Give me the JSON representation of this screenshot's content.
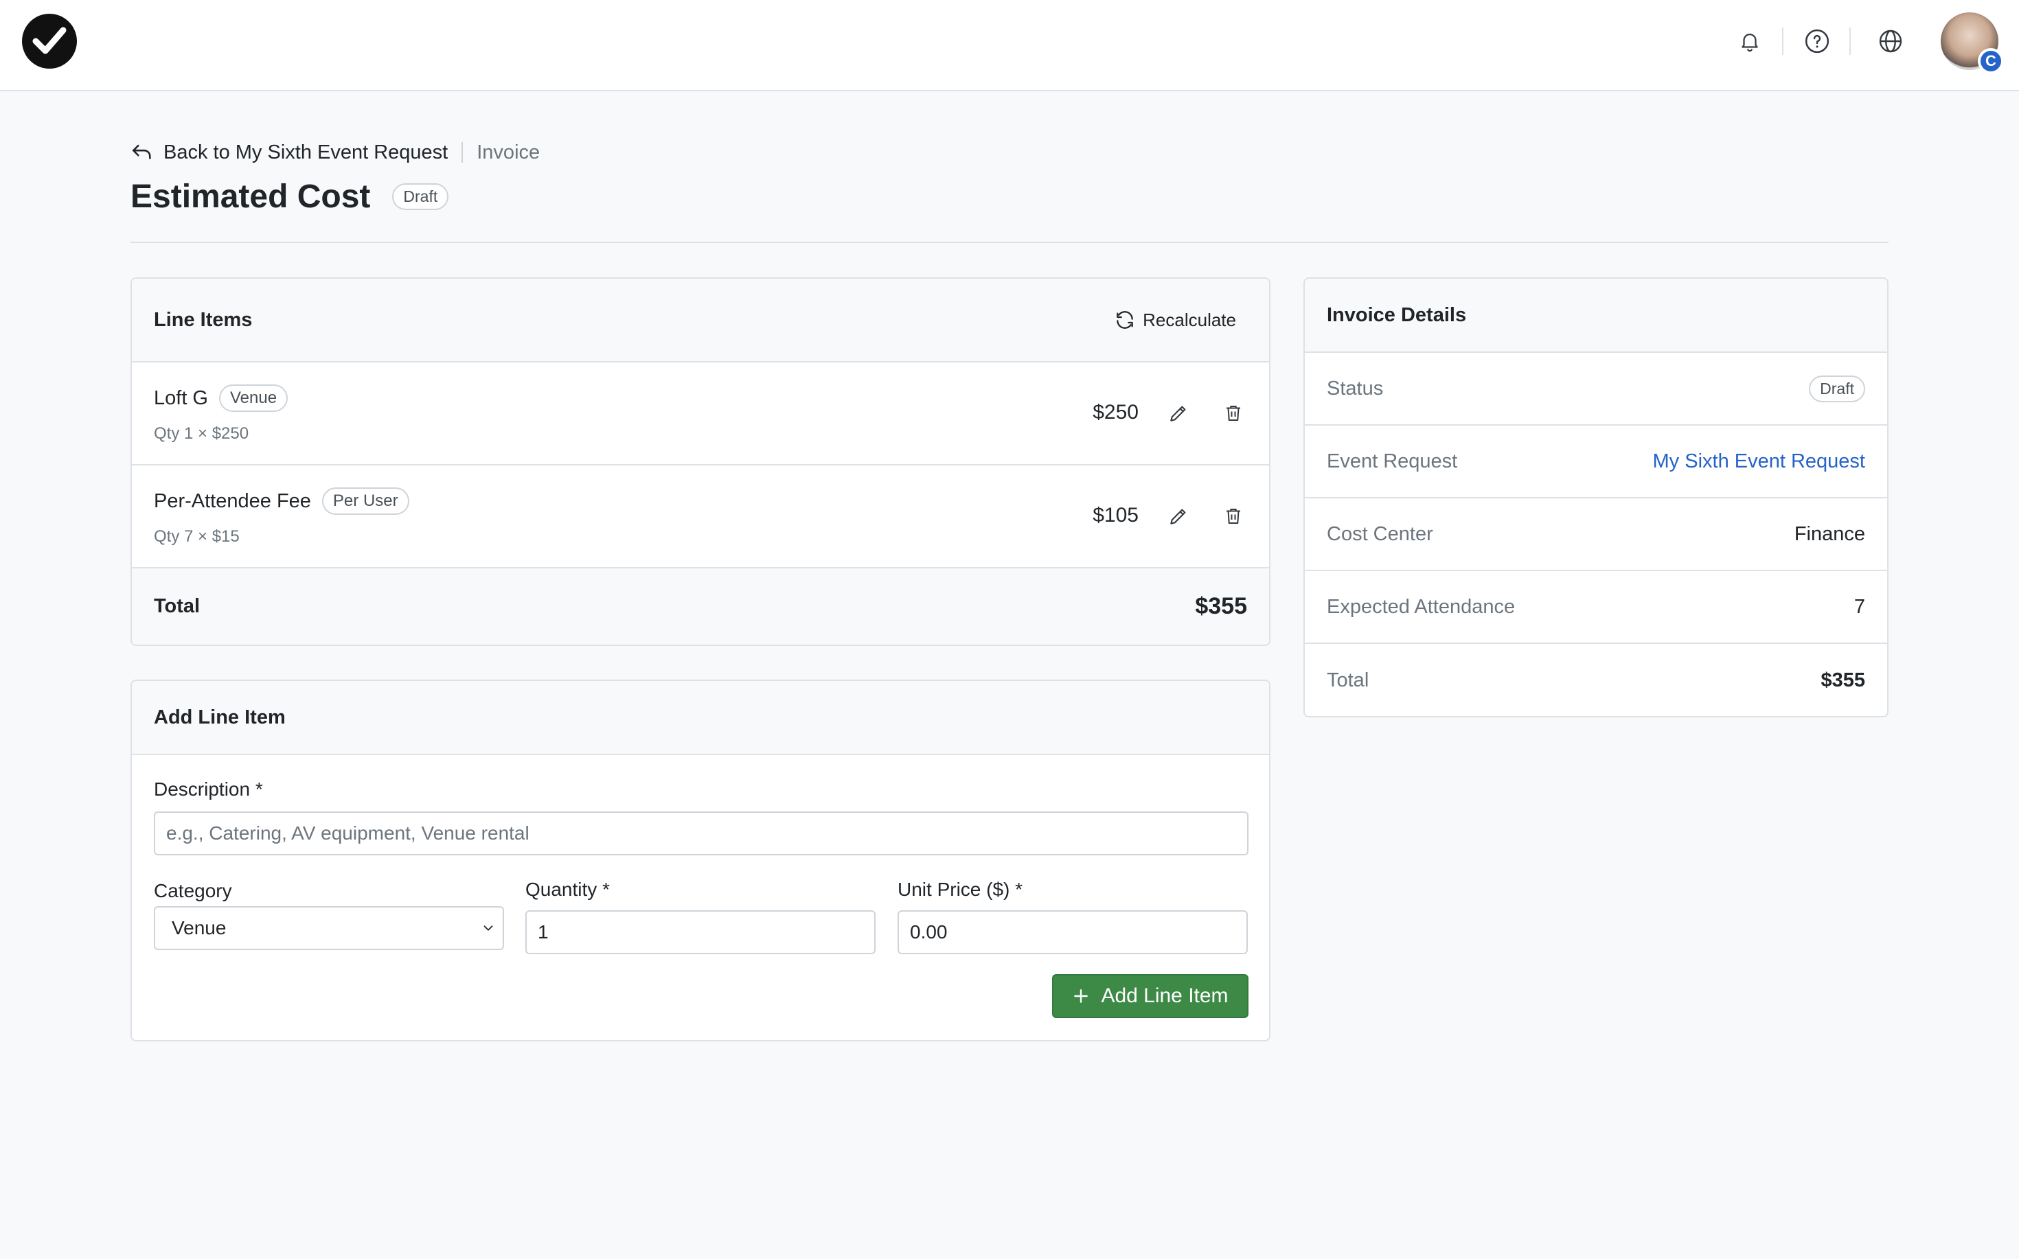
{
  "header": {
    "back_label": "Back to My Sixth Event Request",
    "crumb_current": "Invoice",
    "title": "Estimated Cost",
    "status_badge": "Draft"
  },
  "line_items": {
    "title": "Line Items",
    "recalculate_label": "Recalculate",
    "items": [
      {
        "name": "Loft G",
        "tag": "Venue",
        "detail": "Qty 1 × $250",
        "amount": "$250"
      },
      {
        "name": "Per-Attendee Fee",
        "tag": "Per User",
        "detail": "Qty 7 × $15",
        "amount": "$105"
      }
    ],
    "total_label": "Total",
    "total_value": "$355"
  },
  "add_form": {
    "title": "Add Line Item",
    "description_label": "Description *",
    "description_placeholder": "e.g., Catering, AV equipment, Venue rental",
    "category_label": "Category",
    "category_value": "Venue",
    "quantity_label": "Quantity *",
    "quantity_value": "1",
    "unit_price_label": "Unit Price ($) *",
    "unit_price_value": "0.00",
    "submit_label": "Add Line Item"
  },
  "invoice_details": {
    "title": "Invoice Details",
    "rows": [
      {
        "key": "Status",
        "value": "Draft"
      },
      {
        "key": "Event Request",
        "value": "My Sixth Event Request"
      },
      {
        "key": "Cost Center",
        "value": "Finance"
      },
      {
        "key": "Expected Attendance",
        "value": "7"
      },
      {
        "key": "Total",
        "value": "$355"
      }
    ]
  },
  "topbar": {
    "avatar_badge": "C",
    "icons": [
      "bell-icon",
      "help-icon",
      "globe-icon"
    ]
  },
  "colors": {
    "primary_button": "#3d8a46",
    "link": "#2563c9",
    "background": "#f8f9fa"
  }
}
